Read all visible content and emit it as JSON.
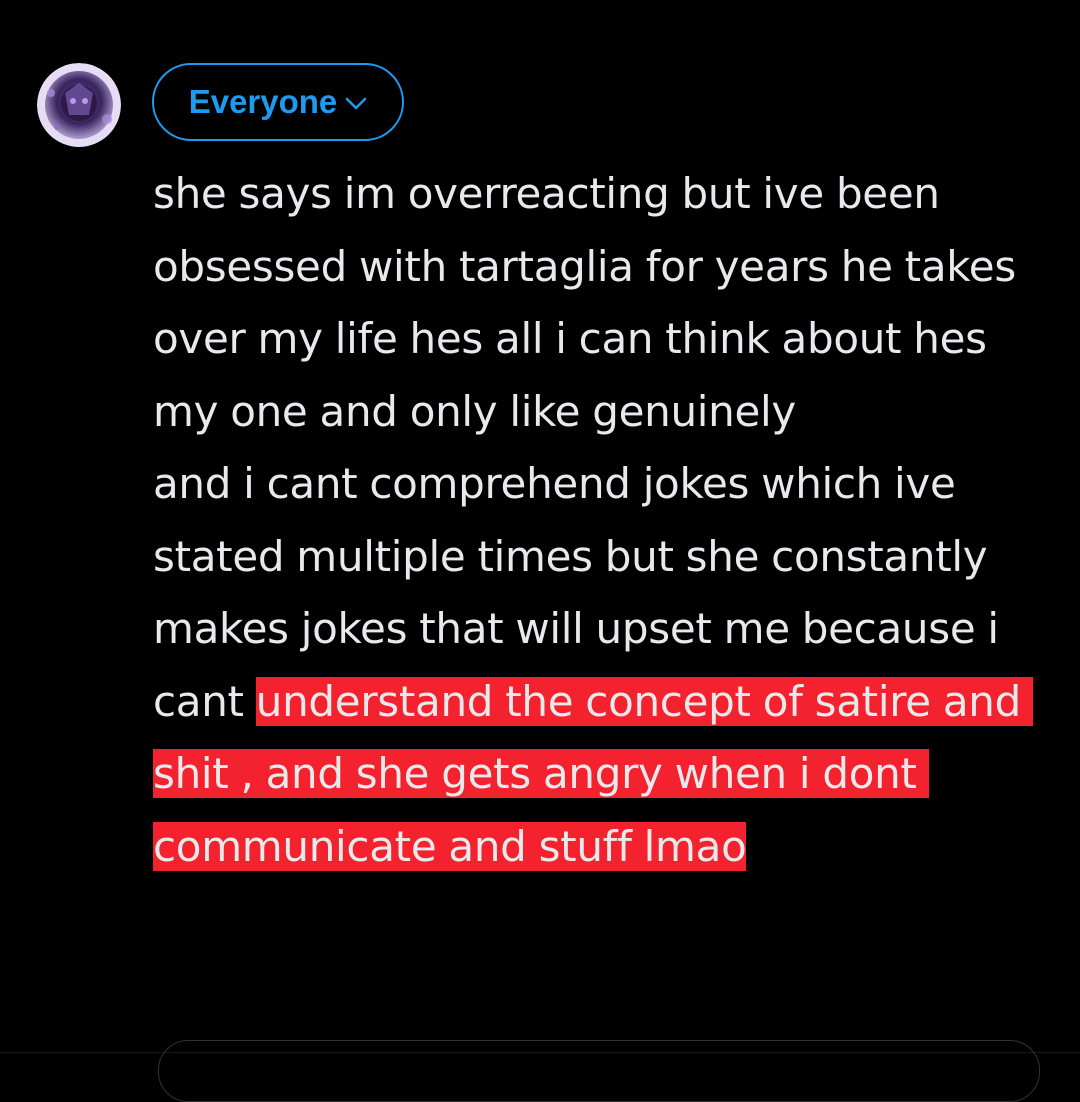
{
  "composer": {
    "audience_label": "Everyone",
    "text_plain": "she says im overreacting but ive been obsessed with tartaglia for years he takes over my life hes all i can think about hes my one and only like genuinely\nand i cant comprehend jokes which ive stated multiple times but she constantly makes jokes that will upset me because i cant ",
    "text_highlighted": "understand the concept of satire and shit , and she gets angry when i dont communicate and stuff lmao"
  },
  "icons": {
    "avatar": "avatar",
    "audience_chevron": "chevron-down-icon"
  },
  "colors": {
    "background": "#000000",
    "text": "#e7e9ea",
    "accent": "#1d9bf0",
    "highlight": "#f4212e"
  }
}
